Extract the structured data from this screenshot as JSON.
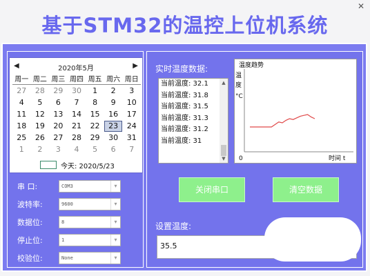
{
  "window": {
    "close_glyph": "✕"
  },
  "app_title": "基于STM32的温控上位机系统",
  "calendar": {
    "prev": "◀",
    "next": "▶",
    "month_title": "2020年5月",
    "weekdays": [
      "周一",
      "周二",
      "周三",
      "周四",
      "周五",
      "周六",
      "周日"
    ],
    "weeks": [
      [
        "27",
        "28",
        "29",
        "30",
        "1",
        "2",
        "3"
      ],
      [
        "4",
        "5",
        "6",
        "7",
        "8",
        "9",
        "10"
      ],
      [
        "11",
        "12",
        "13",
        "14",
        "15",
        "16",
        "17"
      ],
      [
        "18",
        "19",
        "20",
        "21",
        "22",
        "23",
        "24"
      ],
      [
        "25",
        "26",
        "27",
        "28",
        "29",
        "30",
        "31"
      ],
      [
        "1",
        "2",
        "3",
        "4",
        "5",
        "6",
        "7"
      ]
    ],
    "selected_day": "23",
    "today_label": "今天: 2020/5/23"
  },
  "serial": {
    "port": {
      "label": "串  口:",
      "value": "COM3"
    },
    "baud": {
      "label": "波特率:",
      "value": "9600"
    },
    "databits": {
      "label": "数据位:",
      "value": "8"
    },
    "stopbits": {
      "label": "停止位:",
      "value": "1"
    },
    "parity": {
      "label": "校验位:",
      "value": "None"
    }
  },
  "realtime": {
    "label": "实时温度数据:",
    "items": [
      "当前温度: 32.1",
      "当前温度: 31.8",
      "当前温度: 31.5",
      "当前温度: 31.3",
      "当前温度: 31.2",
      "当前温度: 31"
    ]
  },
  "chart": {
    "title": "温度趋势",
    "ylabel_lines": [
      "温",
      "度",
      "°C"
    ],
    "origin": "0",
    "xlabel": "时间 t",
    "line_color": "#e04848"
  },
  "chart_data": {
    "type": "line",
    "title": "温度趋势",
    "xlabel": "时间 t",
    "ylabel": "温度 °C",
    "x": [
      0,
      1,
      2,
      3,
      4,
      5,
      6,
      7,
      8,
      9,
      10,
      11,
      12,
      13,
      14,
      15,
      16,
      17,
      18
    ],
    "values": [
      0.3,
      0.3,
      0.3,
      0.3,
      0.3,
      0.3,
      0.3,
      0.33,
      0.36,
      0.35,
      0.38,
      0.4,
      0.39,
      0.41,
      0.43,
      0.44,
      0.45,
      0.42,
      0.4
    ],
    "ylim": [
      0,
      1
    ],
    "grid": false
  },
  "buttons": {
    "close_port": "关闭串口",
    "clear_data": "清空数据"
  },
  "set_temp": {
    "label": "设置温度:",
    "value": "35.5"
  },
  "colors": {
    "title": "#6868ee",
    "panel": "#7373ec",
    "button": "#8ef08c"
  }
}
